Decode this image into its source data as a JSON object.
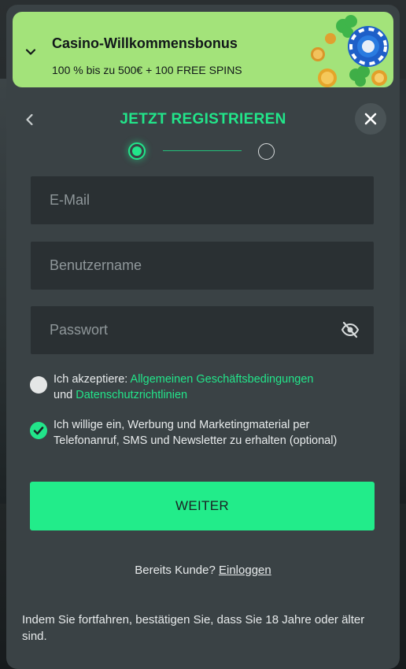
{
  "promo": {
    "title": "Casino-Willkommensbonus",
    "subtitle": "100 % bis zu 500€ + 100 FREE SPINS",
    "icon_toggle": "chevron-down-icon"
  },
  "header": {
    "title": "JETZT REGISTRIEREN",
    "back_icon": "chevron-left-icon",
    "close_icon": "close-icon"
  },
  "stepper": {
    "current_step": 1,
    "total_steps": 2
  },
  "form": {
    "email_placeholder": "E-Mail",
    "username_placeholder": "Benutzername",
    "password_placeholder": "Passwort",
    "password_toggle_icon": "eye-off-icon"
  },
  "consents": {
    "terms": {
      "checked": false,
      "prefix": "Ich akzeptiere: ",
      "link1": "Allgemeinen Geschäftsbedingungen",
      "middle": " und ",
      "link2": "Datenschutzrichtlinien"
    },
    "marketing": {
      "checked": true,
      "text": "Ich willige ein, Werbung und Marketingmaterial per Telefonanruf, SMS und Newsletter zu erhalten (optional)"
    }
  },
  "submit_label": "WEITER",
  "login": {
    "prompt": "Bereits Kunde? ",
    "link": "Einloggen"
  },
  "footer_note": "Indem Sie fortfahren, bestätigen Sie, dass Sie 18 Jahre oder älter sind.",
  "colors": {
    "accent": "#22e58a",
    "promo_bg": "#a3e37a",
    "modal_bg": "#3a4245",
    "input_bg": "#2a3033"
  }
}
